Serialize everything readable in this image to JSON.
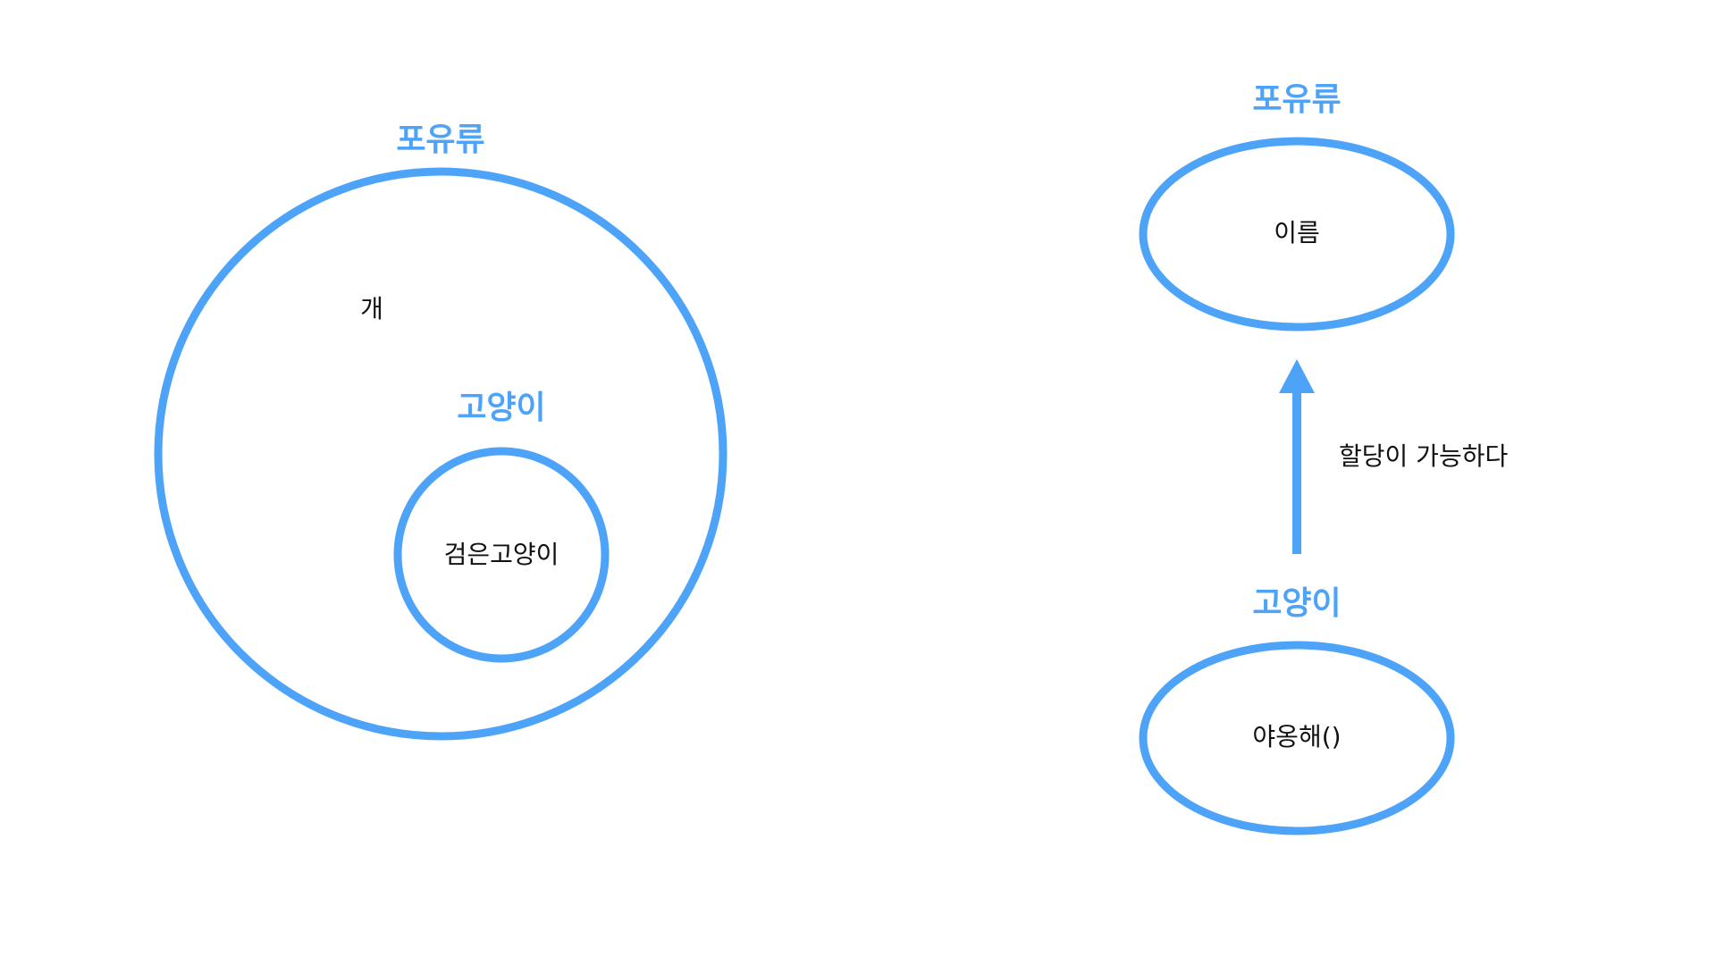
{
  "colors": {
    "accent": "#4da3f8",
    "text": "#111111",
    "background": "#ffffff"
  },
  "left_diagram": {
    "outer_label": "포유류",
    "outer_content": "개",
    "inner_label": "고양이",
    "inner_content": "검은고양이"
  },
  "right_diagram": {
    "top_label": "포유류",
    "top_content": "이름",
    "arrow_label": "할당이 가능하다",
    "bottom_label": "고양이",
    "bottom_content": "야옹해()"
  }
}
